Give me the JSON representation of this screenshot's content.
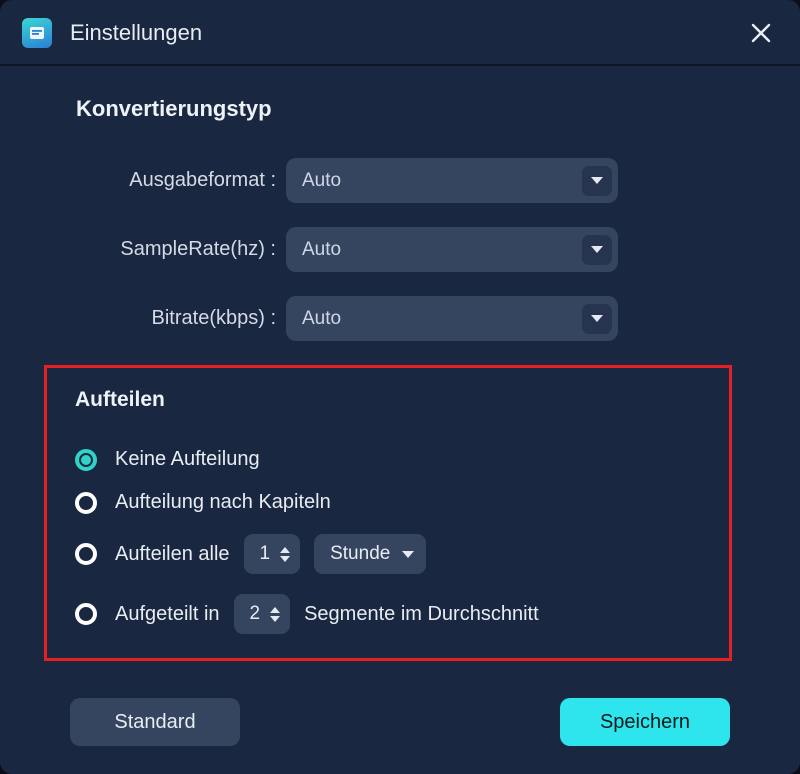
{
  "dialog": {
    "title": "Einstellungen"
  },
  "conversion": {
    "heading": "Konvertierungstyp",
    "output_format": {
      "label": "Ausgabeformat :",
      "value": "Auto"
    },
    "sample_rate": {
      "label": "SampleRate(hz) :",
      "value": "Auto"
    },
    "bitrate": {
      "label": "Bitrate(kbps) :",
      "value": "Auto"
    }
  },
  "split": {
    "heading": "Aufteilen",
    "selected_index": 0,
    "options": {
      "none": {
        "label": "Keine Aufteilung"
      },
      "by_chapter": {
        "label": "Aufteilung nach Kapiteln"
      },
      "by_interval": {
        "label_prefix": "Aufteilen alle",
        "interval_value": "1",
        "unit_value": "Stunde"
      },
      "by_segments": {
        "label_prefix": "Aufgeteilt in",
        "segments_value": "2",
        "label_suffix": "Segmente im Durchschnitt"
      }
    }
  },
  "footer": {
    "default_btn": "Standard",
    "save_btn": "Speichern"
  }
}
